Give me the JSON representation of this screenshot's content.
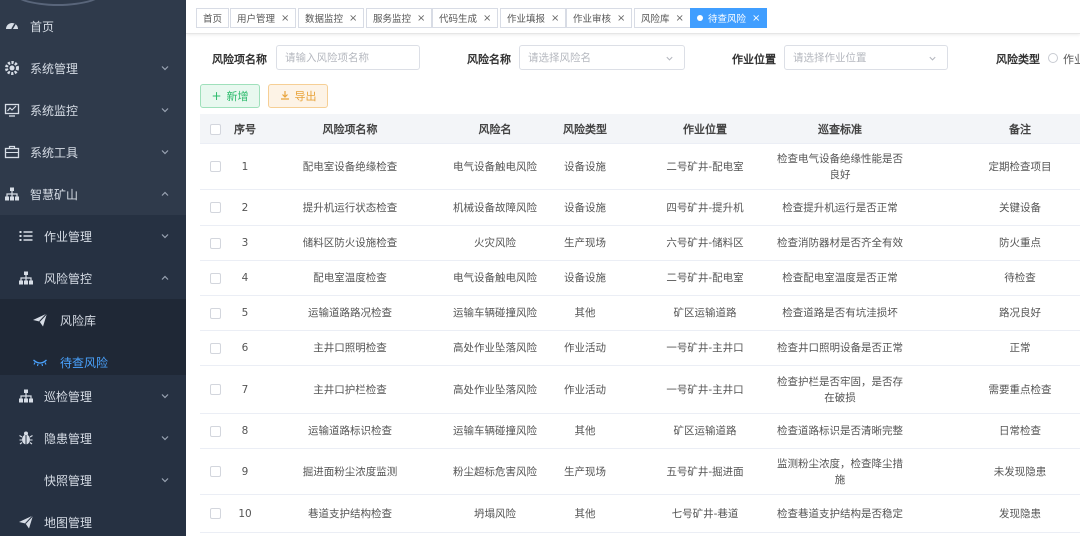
{
  "sidebar": {
    "items": [
      {
        "label": "首页",
        "icon": "dashboard-icon"
      },
      {
        "label": "系统管理",
        "icon": "gear-icon"
      },
      {
        "label": "系统监控",
        "icon": "monitor-icon"
      },
      {
        "label": "系统工具",
        "icon": "toolbox-icon"
      },
      {
        "label": "智慧矿山",
        "icon": "org-tree-icon"
      },
      {
        "label": "作业管理",
        "icon": "list-icon"
      },
      {
        "label": "风险管控",
        "icon": "org-tree-icon"
      },
      {
        "label": "风险库",
        "icon": "paper-plane-icon"
      },
      {
        "label": "待查风险",
        "icon": "eye-closed-icon"
      },
      {
        "label": "巡检管理",
        "icon": "org-tree-icon"
      },
      {
        "label": "隐患管理",
        "icon": "bug-icon"
      },
      {
        "label": "快照管理",
        "icon": ""
      },
      {
        "label": "地图管理",
        "icon": "paper-plane-icon"
      }
    ]
  },
  "tabs": [
    {
      "label": "首页"
    },
    {
      "label": "用户管理"
    },
    {
      "label": "数据监控"
    },
    {
      "label": "服务监控"
    },
    {
      "label": "代码生成"
    },
    {
      "label": "作业填报"
    },
    {
      "label": "作业审核"
    },
    {
      "label": "风险库"
    },
    {
      "label": "待查风险"
    }
  ],
  "filters": {
    "risk_item_label": "风险项名称",
    "risk_item_placeholder": "请输入风险项名称",
    "risk_name_label": "风险名称",
    "risk_name_placeholder": "请选择风险名",
    "location_label": "作业位置",
    "location_placeholder": "请选择作业位置",
    "risk_type_label": "风险类型",
    "risk_type_option": "作业"
  },
  "toolbar": {
    "add_label": "新增",
    "export_label": "导出"
  },
  "table": {
    "columns": [
      "序号",
      "风险项名称",
      "风险名",
      "风险类型",
      "作业位置",
      "巡查标准",
      "备注"
    ],
    "rows": [
      {
        "no": "1",
        "item": "配电室设备绝缘检查",
        "risk": "电气设备触电风险",
        "type": "设备设施",
        "loc": "二号矿井-配电室",
        "std": "检查电气设备绝缘性能是否良好",
        "remark": "定期检查项目"
      },
      {
        "no": "2",
        "item": "提升机运行状态检查",
        "risk": "机械设备故障风险",
        "type": "设备设施",
        "loc": "四号矿井-提升机",
        "std": "检查提升机运行是否正常",
        "remark": "关键设备"
      },
      {
        "no": "3",
        "item": "储料区防火设施检查",
        "risk": "火灾风险",
        "type": "生产现场",
        "loc": "六号矿井-储料区",
        "std": "检查消防器材是否齐全有效",
        "remark": "防火重点"
      },
      {
        "no": "4",
        "item": "配电室温度检查",
        "risk": "电气设备触电风险",
        "type": "设备设施",
        "loc": "二号矿井-配电室",
        "std": "检查配电室温度是否正常",
        "remark": "待检查"
      },
      {
        "no": "5",
        "item": "运输道路路况检查",
        "risk": "运输车辆碰撞风险",
        "type": "其他",
        "loc": "矿区运输道路",
        "std": "检查道路是否有坑洼损坏",
        "remark": "路况良好"
      },
      {
        "no": "6",
        "item": "主井口照明检查",
        "risk": "高处作业坠落风险",
        "type": "作业活动",
        "loc": "一号矿井-主井口",
        "std": "检查井口照明设备是否正常",
        "remark": "正常"
      },
      {
        "no": "7",
        "item": "主井口护栏检查",
        "risk": "高处作业坠落风险",
        "type": "作业活动",
        "loc": "一号矿井-主井口",
        "std": "检查护栏是否牢固，是否存在破损",
        "remark": "需要重点检查"
      },
      {
        "no": "8",
        "item": "运输道路标识检查",
        "risk": "运输车辆碰撞风险",
        "type": "其他",
        "loc": "矿区运输道路",
        "std": "检查道路标识是否清晰完整",
        "remark": "日常检查"
      },
      {
        "no": "9",
        "item": "掘进面粉尘浓度监测",
        "risk": "粉尘超标危害风险",
        "type": "生产现场",
        "loc": "五号矿井-掘进面",
        "std": "监测粉尘浓度，检查降尘措施",
        "remark": "未发现隐患"
      },
      {
        "no": "10",
        "item": "巷道支护结构检查",
        "risk": "坍塌风险",
        "type": "其他",
        "loc": "七号矿井-巷道",
        "std": "检查巷道支护结构是否稳定",
        "remark": "发现隐患"
      }
    ]
  },
  "colors": {
    "sidebar_bg": "#2f3a4b",
    "accent": "#409eff",
    "add_green": "#2dbb6c",
    "export_orange": "#e8a33b"
  }
}
